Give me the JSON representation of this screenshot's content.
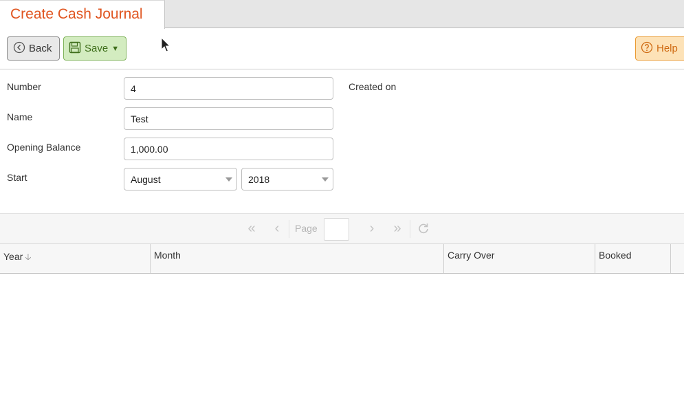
{
  "tab": {
    "title": "Create Cash Journal"
  },
  "toolbar": {
    "back_label": "Back",
    "save_label": "Save",
    "help_label": "Help"
  },
  "form": {
    "number": {
      "label": "Number",
      "value": "4"
    },
    "name": {
      "label": "Name",
      "value": "Test"
    },
    "opening_balance": {
      "label": "Opening Balance",
      "value": "1,000.00"
    },
    "start": {
      "label": "Start",
      "month": "August",
      "year": "2018"
    },
    "created_on_label": "Created on"
  },
  "pager": {
    "page_label": "Page",
    "page_value": ""
  },
  "grid": {
    "columns": [
      "Year",
      "Month",
      "Carry Over",
      "Booked"
    ],
    "sort_column": "Year",
    "sort_direction": "descending"
  },
  "colors": {
    "accent": "#e0541f",
    "save_bg": "#d3ecc0",
    "help_bg": "#fde2b7"
  }
}
